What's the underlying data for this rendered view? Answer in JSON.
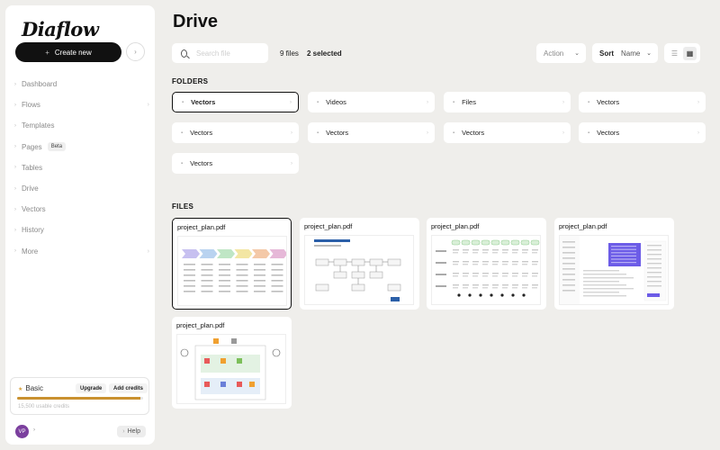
{
  "sidebar": {
    "logo": "Diaflow",
    "create_label": "Create new",
    "create_icon": "plus-icon",
    "nav": [
      {
        "label": "Dashboard",
        "has_children": false
      },
      {
        "label": "Flows",
        "has_children": true
      },
      {
        "label": "Templates",
        "has_children": false
      },
      {
        "label": "Pages",
        "badge": "Beta",
        "has_children": false
      },
      {
        "label": "Tables",
        "has_children": false
      },
      {
        "label": "Drive",
        "has_children": false
      },
      {
        "label": "Vectors",
        "has_children": false
      },
      {
        "label": "History",
        "has_children": false
      },
      {
        "label": "More",
        "has_children": true
      }
    ],
    "plan": {
      "name": "Basic",
      "upgrade_label": "Upgrade",
      "add_credits_label": "Add credits",
      "credits_text": "15,500 usable credits",
      "usage_fraction": 0.98,
      "accent": "#c9912f"
    },
    "user": {
      "initials": "VP",
      "avatar_color": "#7b3f9e"
    },
    "help_label": "Help"
  },
  "main": {
    "title": "Drive",
    "search_placeholder": "Search file",
    "file_count": "9 files",
    "selected_count": "2 selected",
    "action_label": "Action",
    "sort_label": "Sort",
    "sort_value": "Name",
    "folders_label": "FOLDERS",
    "folders": [
      {
        "name": "Vectors",
        "selected": true
      },
      {
        "name": "Videos",
        "selected": false
      },
      {
        "name": "Files",
        "selected": false
      },
      {
        "name": "Vectors",
        "selected": false
      },
      {
        "name": "Vectors",
        "selected": false
      },
      {
        "name": "Vectors",
        "selected": false
      },
      {
        "name": "Vectors",
        "selected": false
      },
      {
        "name": "Vectors",
        "selected": false
      },
      {
        "name": "Vectors",
        "selected": false
      }
    ],
    "files_label": "FILES",
    "files": [
      {
        "name": "project_plan.pdf",
        "selected": true,
        "thumb": "process-arrows"
      },
      {
        "name": "project_plan.pdf",
        "selected": false,
        "thumb": "flowchart"
      },
      {
        "name": "project_plan.pdf",
        "selected": false,
        "thumb": "swimlane"
      },
      {
        "name": "project_plan.pdf",
        "selected": false,
        "thumb": "app-screenshot"
      },
      {
        "name": "project_plan.pdf",
        "selected": false,
        "thumb": "architecture"
      }
    ]
  }
}
